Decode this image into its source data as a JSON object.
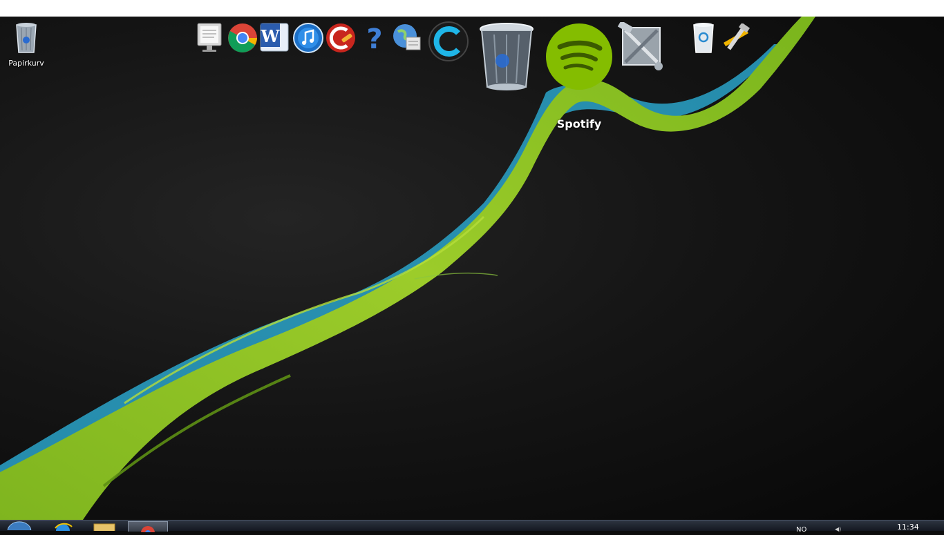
{
  "desktop": {
    "icons": [
      {
        "label": "Papirkurv",
        "icon": "recycle-bin-icon"
      }
    ]
  },
  "dock": {
    "hover_label": "Spotify",
    "items": [
      {
        "icon": "monitor-document-icon"
      },
      {
        "icon": "chrome-icon"
      },
      {
        "icon": "word-icon"
      },
      {
        "icon": "itunes-icon"
      },
      {
        "icon": "ccleaner-icon"
      },
      {
        "icon": "help-icon"
      },
      {
        "icon": "network-globe-icon"
      },
      {
        "icon": "c-app-icon"
      },
      {
        "icon": "trash-can-icon"
      },
      {
        "icon": "spotify-icon"
      },
      {
        "icon": "system-tools-icon"
      },
      {
        "icon": "small-recycle-bin-icon"
      },
      {
        "icon": "hammer-wrench-icon"
      }
    ]
  },
  "taskbar": {
    "language": "NO",
    "time": "11:34"
  },
  "colors": {
    "accent_green": "#8cc63f",
    "accent_blue": "#2aa3c9"
  }
}
